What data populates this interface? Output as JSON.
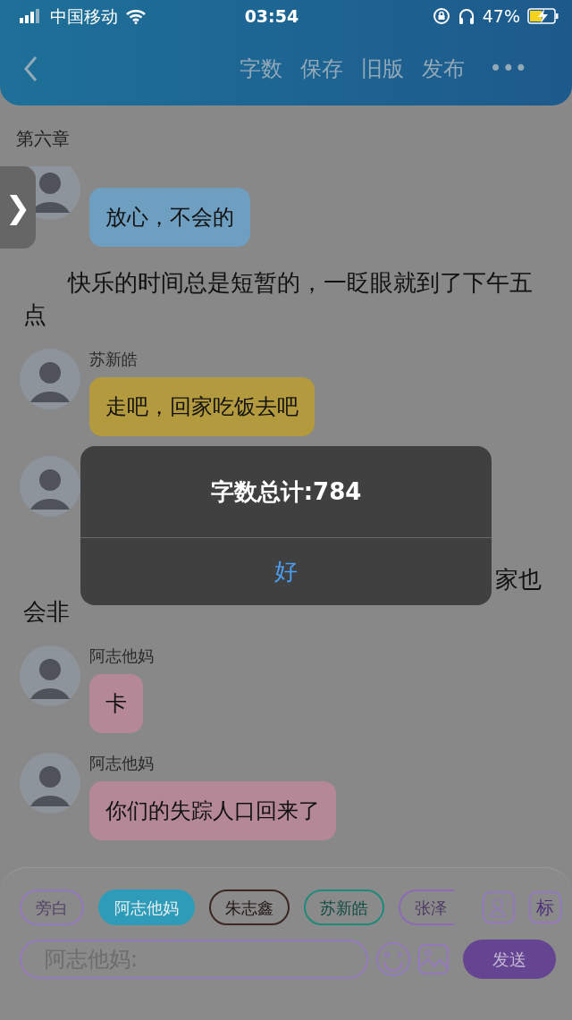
{
  "status_bar": {
    "carrier": "中国移动",
    "time": "03:54",
    "battery_text": "47%"
  },
  "header": {
    "actions": [
      "字数",
      "保存",
      "旧版",
      "发布"
    ],
    "more": "•••"
  },
  "chapter_title": "第六章",
  "side_tab": {
    "label": "❯"
  },
  "messages": [
    {
      "kind": "message",
      "text": "放心，不会的",
      "color": "#6e9ec0"
    },
    {
      "kind": "narration",
      "text": "快乐的时间总是短暂的，一眨眼就到了下午五点"
    },
    {
      "kind": "message",
      "name": "苏新皓",
      "text": "走吧，回家吃饭去吧",
      "color": "#b39a3e"
    },
    {
      "kind": "message"
    },
    {
      "kind": "narration_partial",
      "end": "家也",
      "rest": "会非"
    },
    {
      "kind": "message",
      "name": "阿志他妈",
      "text": "卡",
      "color": "#b48896"
    },
    {
      "kind": "message",
      "name": "阿志他妈",
      "text": "你们的失踪人口回来了",
      "color": "#b48896"
    }
  ],
  "roles": [
    {
      "label": "旁白",
      "color": "#9478bd",
      "selected": false
    },
    {
      "label": "阿志他妈",
      "color": "#2e9cb8",
      "selected": true
    },
    {
      "label": "朱志鑫",
      "color": "#3b2822",
      "selected": false
    },
    {
      "label": "苏新皓",
      "color": "#1f8a78",
      "selected": false
    },
    {
      "label": "张泽",
      "color": "#8c6ab5",
      "selected": false
    }
  ],
  "tag_button": "标",
  "input": {
    "placeholder": "阿志他妈:"
  },
  "send_button": "发送",
  "dialog": {
    "message": "字数总计:784",
    "button": "好"
  }
}
